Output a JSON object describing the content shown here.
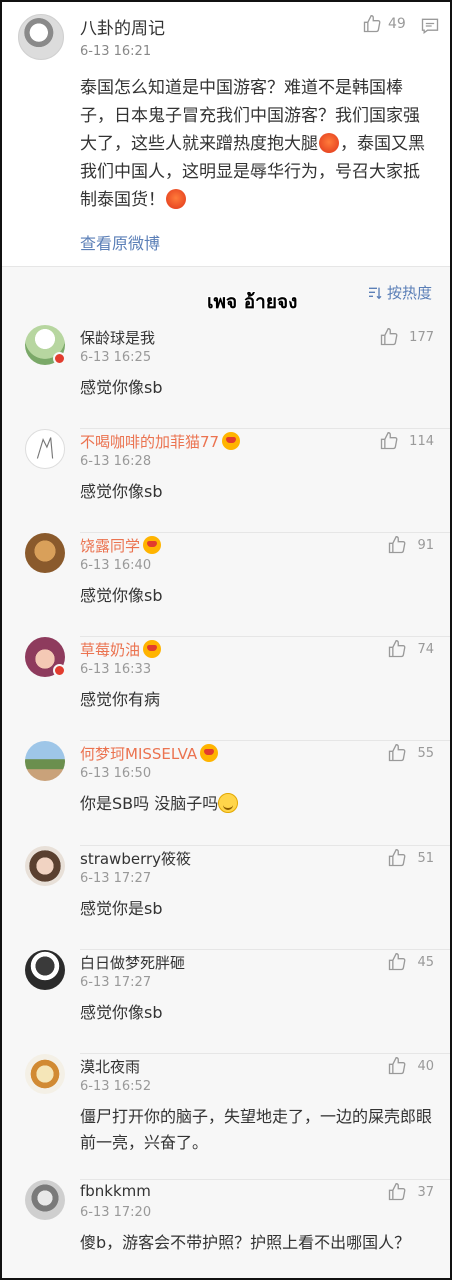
{
  "post": {
    "author": "八卦的周记",
    "time": "6-13 16:21",
    "likes": "49",
    "content_part1": "泰国怎么知道是中国游客？难道不是韩国棒子，日本鬼子冒充我们中国游客？我们国家强大了，这些人就来蹭热度抱大腿",
    "content_part2": "，泰国又黑我们中国人，这明显是辱华行为，号召大家抵制泰国货！",
    "view_original": "查看原微博"
  },
  "watermark": "เพจ อ้ายจง",
  "sort_label": "按热度",
  "comments": [
    {
      "name": "保龄球是我",
      "time": "6-13 16:25",
      "likes": "177",
      "text": "感觉你像sb"
    },
    {
      "name": "不喝咖啡的加菲猫77",
      "time": "6-13 16:28",
      "likes": "114",
      "text": "感觉你像sb"
    },
    {
      "name": "饶露同学",
      "time": "6-13 16:40",
      "likes": "91",
      "text": "感觉你像sb"
    },
    {
      "name": "草莓奶油",
      "time": "6-13 16:33",
      "likes": "74",
      "text": "感觉你有病"
    },
    {
      "name": "何梦珂MISSELVA",
      "time": "6-13 16:50",
      "likes": "55",
      "text": "你是SB吗 没脑子吗"
    },
    {
      "name": "strawberry筱筱",
      "time": "6-13 17:27",
      "likes": "51",
      "text": "感觉你是sb"
    },
    {
      "name": "白日做梦死胖砸",
      "time": "6-13 17:27",
      "likes": "45",
      "text": "感觉你像sb"
    },
    {
      "name": "漠北夜雨",
      "time": "6-13 16:52",
      "likes": "40",
      "text": "僵尸打开你的脑子，失望地走了，一边的屎壳郎眼前一亮，兴奋了。"
    },
    {
      "name": "fbnkkmm",
      "time": "6-13 17:20",
      "likes": "37",
      "text": "傻b，游客会不带护照？护照上看不出哪国人？"
    }
  ],
  "colors": {
    "link": "#5b7fb7",
    "vip_name": "#eb7350",
    "meta": "#999999"
  }
}
